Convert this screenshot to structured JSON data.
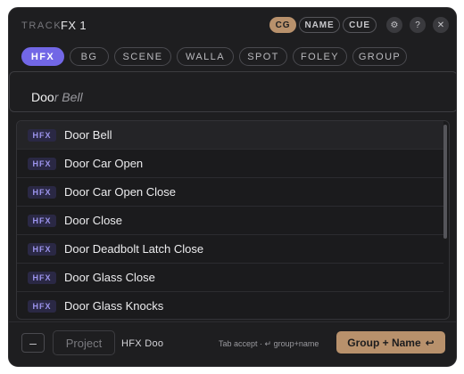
{
  "header": {
    "track_label": "TRACK",
    "track_name": "FX 1",
    "mode_buttons": [
      {
        "label": "CG",
        "active": true
      },
      {
        "label": "NAME",
        "active": false
      },
      {
        "label": "CUE",
        "active": false
      }
    ],
    "icons": [
      "gear-icon",
      "help-icon",
      "close-icon"
    ],
    "icon_glyphs": [
      "⚙",
      "?",
      "✕"
    ]
  },
  "tabs": [
    {
      "label": "HFX",
      "active": true
    },
    {
      "label": "BG",
      "active": false
    },
    {
      "label": "SCENE",
      "active": false
    },
    {
      "label": "WALLA",
      "active": false
    },
    {
      "label": "SPOT",
      "active": false
    },
    {
      "label": "FOLEY",
      "active": false
    },
    {
      "label": "GROUP",
      "active": false
    }
  ],
  "search": {
    "typed": "Doo",
    "autocomplete": "r Bell"
  },
  "results": [
    {
      "badge": "HFX",
      "label": "Door Bell"
    },
    {
      "badge": "HFX",
      "label": "Door Car Open"
    },
    {
      "badge": "HFX",
      "label": "Door Car Open Close"
    },
    {
      "badge": "HFX",
      "label": "Door Close"
    },
    {
      "badge": "HFX",
      "label": "Door Deadbolt Latch Close"
    },
    {
      "badge": "HFX",
      "label": "Door Glass Close"
    },
    {
      "badge": "HFX",
      "label": "Door Glass Knocks"
    }
  ],
  "footer": {
    "minus_label": "–",
    "project_placeholder": "Project",
    "preview": "HFX Doo",
    "hint": "Tab accept · ↵ group+name",
    "accept_label": "Group + Name",
    "accept_icon": "↩"
  },
  "colors": {
    "accent_purple": "#7267e6",
    "accent_tan": "#b8916c",
    "panel_bg": "#1e1e20"
  }
}
